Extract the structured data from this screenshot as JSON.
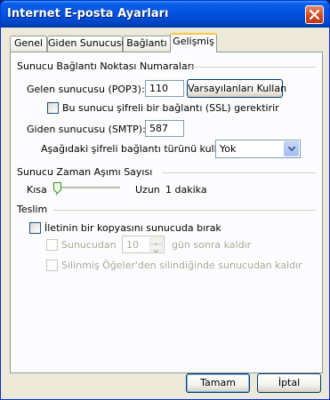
{
  "window": {
    "title": "Internet E-posta Ayarları"
  },
  "tabs": [
    {
      "label": "Genel"
    },
    {
      "label": "Giden Sunucusu"
    },
    {
      "label": "Bağlantı"
    },
    {
      "label": "Gelişmiş",
      "active": true
    }
  ],
  "ports": {
    "section_title": "Sunucu Bağlantı Noktası Numaraları",
    "incoming_label": "Gelen sunucusu (POP3):",
    "incoming_value": "110",
    "defaults_button": "Varsayılanları Kullan",
    "ssl_label": "Bu sunucu şifreli bir bağlantı (SSL) gerektirir",
    "ssl_checked": false,
    "outgoing_label": "Giden sunucusu (SMTP):",
    "outgoing_value": "587",
    "encryption_label": "Aşağıdaki şifreli bağlantı türünü kullan:",
    "encryption_value": "Yok"
  },
  "timeout": {
    "section_title": "Sunucu Zaman Aşımı Sayısı",
    "short_label": "Kısa",
    "long_label": "Uzun",
    "value_label": "1 dakika",
    "slider_level": 0.0
  },
  "delivery": {
    "section_title": "Teslim",
    "leave_copy_label": "İletinin bir kopyasını sunucuda bırak",
    "leave_copy_checked": false,
    "remove_after_prefix": "Sunucudan",
    "remove_after_value": "10",
    "remove_after_suffix": "gün sonra kaldır",
    "remove_deleted_label": "Silinmiş Öğeler'den silindiğinde sunucudan kaldır"
  },
  "footer": {
    "ok_label": "Tamam",
    "cancel_label": "İptal"
  },
  "colors": {
    "titlebar": "#0054e3",
    "dialog_bg": "#ece9d8",
    "active_tab_highlight": "#ffc83c"
  }
}
